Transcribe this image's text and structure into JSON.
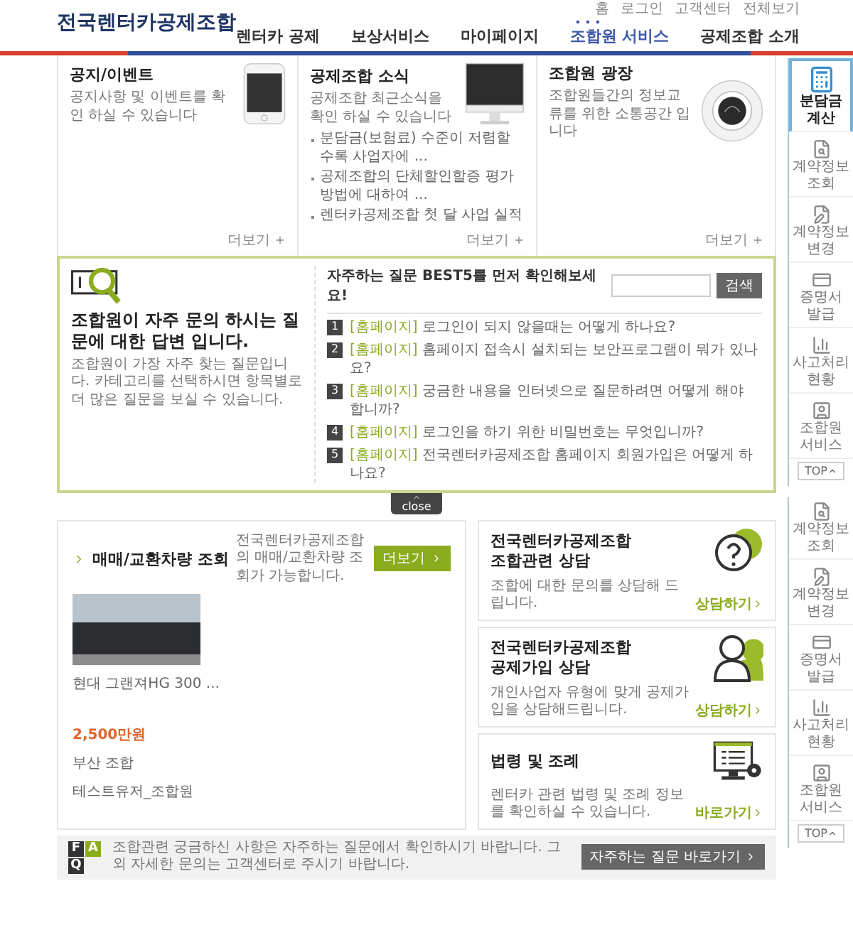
{
  "header": {
    "logo": "전국렌터카공제조합",
    "util_links": [
      "홈",
      "로그인",
      "고객센터",
      "전체보기"
    ],
    "nav": [
      {
        "label": "렌터카 공제",
        "selected": false
      },
      {
        "label": "보상서비스",
        "selected": false
      },
      {
        "label": "마이페이지",
        "selected": false
      },
      {
        "label": "조합원 서비스",
        "selected": true
      },
      {
        "label": "공제조합 소개",
        "selected": false
      }
    ]
  },
  "feature_cards": [
    {
      "kind": "phone",
      "title": "공지/이벤트",
      "description": "공지사항 및 이벤트를 확인 하실 수 있습니다",
      "more": "더보기"
    },
    {
      "kind": "monitor",
      "title": "공제조합 소식",
      "description": "공제조합 최근소식을 확인 하실 수 있습니다",
      "news": [
        "분담금(보험료) 수준이 저렴할수록 사업자에 ...",
        "공제조합의 단체할인할증 평가방법에 대하여 ...",
        "렌터카공제조합 첫 달 사업 실적"
      ],
      "more": "더보기"
    },
    {
      "kind": "cup",
      "title": "조합원 광장",
      "description": "조합원들간의 정보교류를 위한 소통공간 입니다",
      "more": "더보기"
    }
  ],
  "faq": {
    "headline": "조합원이 **자주 문의** 하시는 **질문**에 대한 **답변** 입니다.",
    "description": "조합원이 가장 자주 찾는 질문입니다. 카테고리를 선택하시면 항목별로 더 많은 질문을 보실 수 있습니다.",
    "heading": "자주하는 질문 **BEST5**를 먼저 확인해보세요!",
    "search_button": "검색",
    "questions": [
      {
        "number": "1",
        "category": "[홈페이지]",
        "text": "로그인이 되지 않을때는 어떻게 하나요?"
      },
      {
        "number": "2",
        "category": "[홈페이지]",
        "text": "홈페이지 접속시 설치되는 보안프로그램이 뭐가 있나요?"
      },
      {
        "number": "3",
        "category": "[홈페이지]",
        "text": "궁금한 내용을 인터넷으로 질문하려면 어떻게 해야 합니까?"
      },
      {
        "number": "4",
        "category": "[홈페이지]",
        "text": "로그인을 하기 위한 비밀번호는 무엇입니까?"
      },
      {
        "number": "5",
        "category": "[홈페이지]",
        "text": "전국렌터카공제조합 홈페이지 회원가입은 어떻게 하나요?"
      }
    ],
    "close": "close"
  },
  "vehicles": {
    "title": "매매/교환차량 조회",
    "description": "전국렌터카공제조합의 매매/교환차량 조회가 가능합니다.",
    "more": "더보기",
    "items": [
      {
        "name": "현대 그랜져HG 300 ...",
        "price": "2,500만원",
        "location": "부산 조합",
        "seller": "테스트유저_조합원"
      }
    ]
  },
  "consult_cards": [
    {
      "kind": "question",
      "org": "전국렌터카공제조합",
      "title": "조합관련 상담",
      "description": "조합에 대한 문의를 상담해 드립니다.",
      "link": "상담하기"
    },
    {
      "kind": "person",
      "org": "전국렌터카공제조합",
      "title": "공제가입 상담",
      "description": "개인사업자 유형에 맞게 공제가입을 상담해드립니다.",
      "link": "상담하기"
    },
    {
      "kind": "law",
      "title": "법령 및 조례",
      "description": "렌터카 관련 법령 및 조례 정보를 확인하실 수 있습니다.",
      "link": "바로가기"
    }
  ],
  "faq_banner": {
    "letters": [
      "F",
      "A",
      "Q"
    ],
    "text": "조합관련 궁금하신 사항은 자주하는 질문에서 확인하시기 바랍니다. 그 외 자세한 문의는 고객센터로 주시기 바랍니다.",
    "button": "자주하는 질문 바로가기"
  },
  "quick_menu": [
    {
      "items": [
        {
          "kind": "calculator",
          "label": "분담금 계산",
          "selected": true
        },
        {
          "kind": "search",
          "label": "계약정보 조회",
          "selected": false
        },
        {
          "kind": "edit",
          "label": "계약정보 변경",
          "selected": false
        },
        {
          "kind": "certificate",
          "label": "증명서 발급",
          "selected": false
        },
        {
          "kind": "chart",
          "label": "사고처리 현황",
          "selected": false
        },
        {
          "kind": "member",
          "label": "조합원 서비스",
          "selected": false
        }
      ],
      "top": "TOP"
    },
    {
      "items": [
        {
          "kind": "search",
          "label": "계약정보 조회",
          "selected": false
        },
        {
          "kind": "edit",
          "label": "계약정보 변경",
          "selected": false
        },
        {
          "kind": "certificate",
          "label": "증명서 발급",
          "selected": false
        },
        {
          "kind": "chart",
          "label": "사고처리 현황",
          "selected": false
        },
        {
          "kind": "member",
          "label": "조합원 서비스",
          "selected": false
        }
      ],
      "top": "TOP"
    }
  ]
}
